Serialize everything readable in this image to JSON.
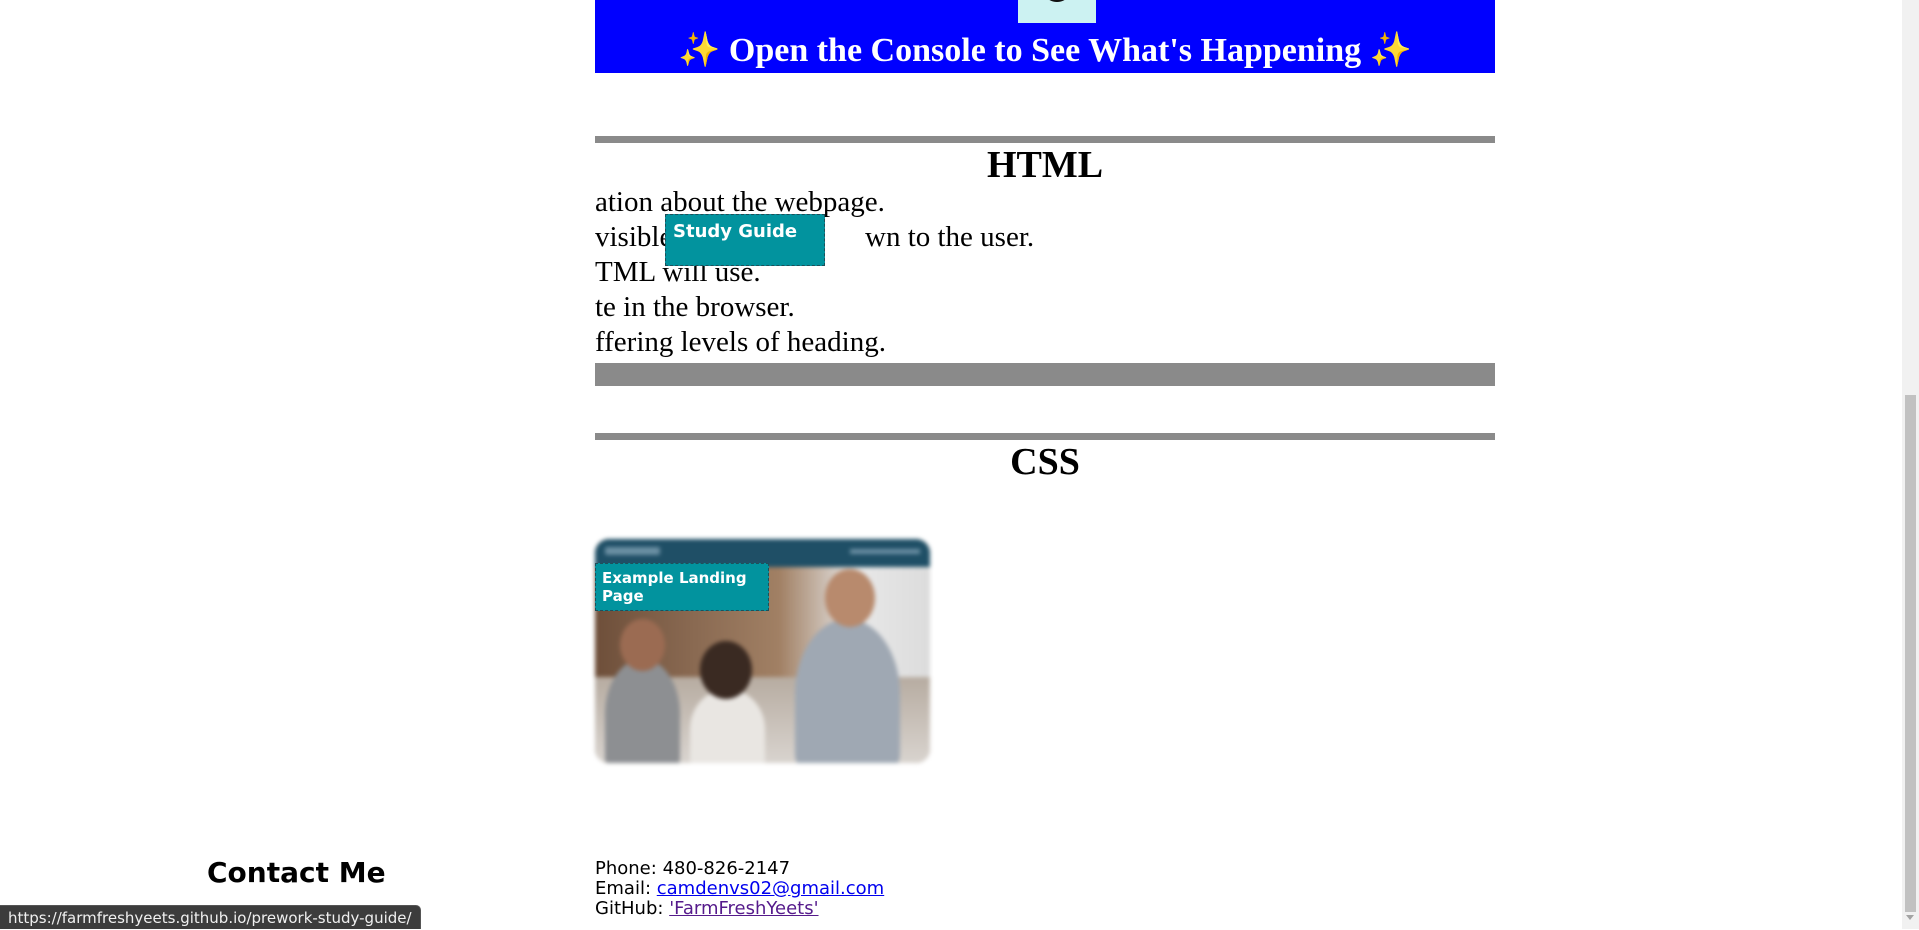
{
  "banner": {
    "text": "Open the Console to See What's Happening",
    "sparkle_left": "✨",
    "sparkle_right": "✨"
  },
  "html_section": {
    "title": "HTML",
    "lines": [
      "ation about the webpage.",
      "visible",
      "wn to the user.",
      "TML will use.",
      "te in the browser.",
      "ffering levels of heading."
    ],
    "overlay_label": "Study Guide"
  },
  "css_section": {
    "title": "CSS",
    "overlay_label": "Example Landing Page"
  },
  "footer": {
    "title": "Contact Me",
    "phone_label": "Phone:",
    "phone": "480-826-2147",
    "email_label": "Email:",
    "email": "camdenvs02@gmail.com",
    "github_label": "GitHub:",
    "github": "'FarmFreshYeets'"
  },
  "status_bar": {
    "url": "https://farmfreshyeets.github.io/prework-study-guide/"
  }
}
